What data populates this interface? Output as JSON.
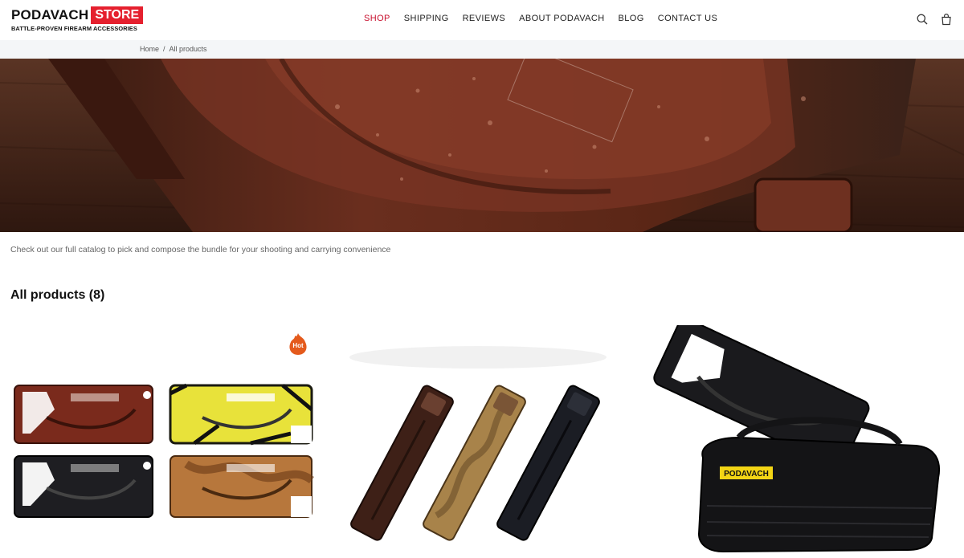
{
  "brand": {
    "name": "PODAVACH",
    "store": "STORE",
    "tagline": "BATTLE-PROVEN FIREARM ACCESSORIES",
    "accent": "#e5202e"
  },
  "nav": {
    "items": [
      {
        "label": "SHOP",
        "active": true
      },
      {
        "label": "SHIPPING"
      },
      {
        "label": "REVIEWS"
      },
      {
        "label": "ABOUT PODAVACH"
      },
      {
        "label": "BLOG"
      },
      {
        "label": "CONTACT US"
      }
    ],
    "active_color": "#c8102e"
  },
  "header_icons": [
    "search-icon",
    "cart-icon"
  ],
  "breadcrumb": {
    "home": "Home",
    "separator": "/",
    "current": "All products"
  },
  "catalog": {
    "description": "Check out our full catalog to pick and compose the bundle for your shooting and carrying convenience",
    "heading": "All products (8)"
  },
  "products": [
    {
      "badge": "Hot",
      "image": "four-loader-colors"
    },
    {
      "image": "three-magazine-loaders"
    },
    {
      "image": "loader-with-bag",
      "bag_label": "PODAVACH"
    }
  ]
}
